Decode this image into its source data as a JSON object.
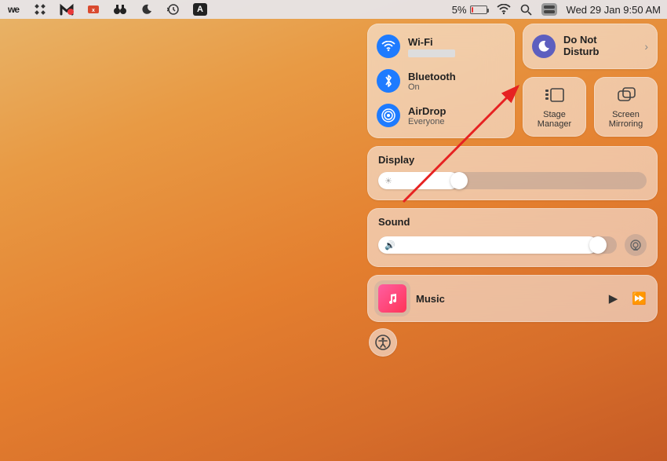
{
  "menubar": {
    "battery_pct": "5%",
    "datetime": "Wed 29 Jan  9:50 AM",
    "icons": [
      "wetransfer",
      "app1",
      "malwarebytes",
      "xvnc",
      "binoculars",
      "moon",
      "time-machine",
      "input-source"
    ]
  },
  "cc": {
    "wifi": {
      "label": "Wi-Fi",
      "status": ""
    },
    "bluetooth": {
      "label": "Bluetooth",
      "status": "On"
    },
    "airdrop": {
      "label": "AirDrop",
      "status": "Everyone"
    },
    "dnd": {
      "label": "Do Not\nDisturb"
    },
    "stage": {
      "label": "Stage\nManager"
    },
    "screen": {
      "label": "Screen\nMirroring"
    },
    "display": {
      "label": "Display",
      "value_pct": 30
    },
    "sound": {
      "label": "Sound",
      "value_pct": 92
    },
    "music": {
      "label": "Music"
    }
  }
}
